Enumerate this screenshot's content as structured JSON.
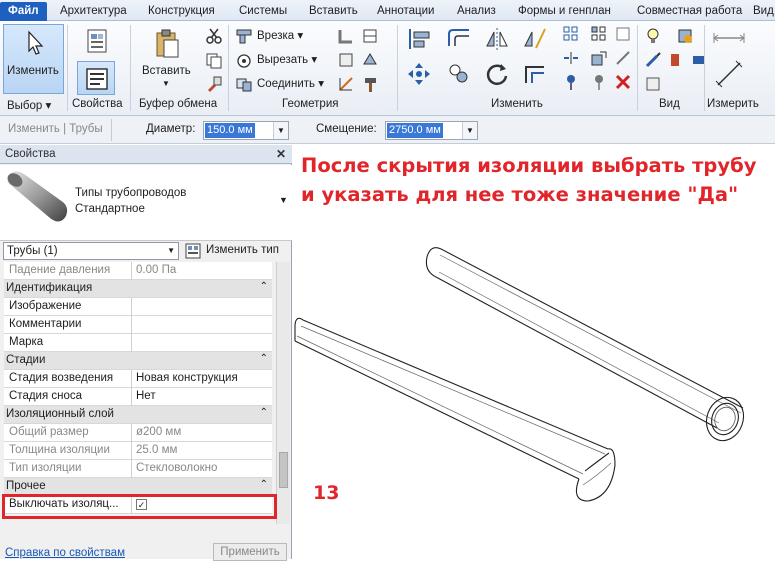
{
  "tabs": [
    "Файл",
    "Архитектура",
    "Конструкция",
    "Системы",
    "Вставить",
    "Аннотации",
    "Анализ",
    "Формы и генплан",
    "Совместная работа",
    "Вид"
  ],
  "ribbon": {
    "modify_label": "Изменить",
    "paste_label": "Вставить",
    "cope_label": "Врезка",
    "cut_label": "Вырезать",
    "join_label": "Соединить",
    "groups": {
      "select": "Выбор",
      "properties": "Свойства",
      "clipboard": "Буфер обмена",
      "geometry": "Геометрия",
      "modify": "Изменить",
      "view": "Вид",
      "measure": "Измерить"
    }
  },
  "optbar": {
    "context": "Изменить | Трубы",
    "diameter_label": "Диаметр:",
    "diameter_value": "150.0 мм",
    "offset_label": "Смещение:",
    "offset_value": "2750.0 мм"
  },
  "properties": {
    "title": "Свойства",
    "type_line1": "Типы трубопроводов",
    "type_line2": "Стандартное",
    "filter": "Трубы (1)",
    "edit_type": "Изменить тип",
    "rows": [
      {
        "kind": "param",
        "name": "Падение давления",
        "value": "0.00 Па",
        "grey": true
      },
      {
        "kind": "cat",
        "name": "Идентификация"
      },
      {
        "kind": "param",
        "name": "Изображение",
        "value": ""
      },
      {
        "kind": "param",
        "name": "Комментарии",
        "value": ""
      },
      {
        "kind": "param",
        "name": "Марка",
        "value": ""
      },
      {
        "kind": "cat",
        "name": "Стадии"
      },
      {
        "kind": "param",
        "name": "Стадия возведения",
        "value": "Новая конструкция"
      },
      {
        "kind": "param",
        "name": "Стадия сноса",
        "value": "Нет"
      },
      {
        "kind": "cat",
        "name": "Изоляционный слой"
      },
      {
        "kind": "param",
        "name": "Общий размер",
        "value": "ø200 мм",
        "grey": true
      },
      {
        "kind": "param",
        "name": "Толщина изоляции",
        "value": "25.0 мм",
        "grey": true
      },
      {
        "kind": "param",
        "name": "Тип изоляции",
        "value": "Стекловолокно",
        "grey": true
      },
      {
        "kind": "cat",
        "name": "Прочее"
      },
      {
        "kind": "param",
        "name": "Выключать изоляц...",
        "value": "✓"
      }
    ],
    "help_link": "Справка по свойствам",
    "apply": "Применить"
  },
  "annotation": {
    "text": "После скрытия изоляции выбрать трубу и указать для нее тоже значение \"Да\"",
    "step": "13",
    "color": "#e0262b"
  },
  "colors": {
    "file_tab": "#1f5fbf",
    "selection": "#3a78d8",
    "highlight": "#e0262b"
  }
}
